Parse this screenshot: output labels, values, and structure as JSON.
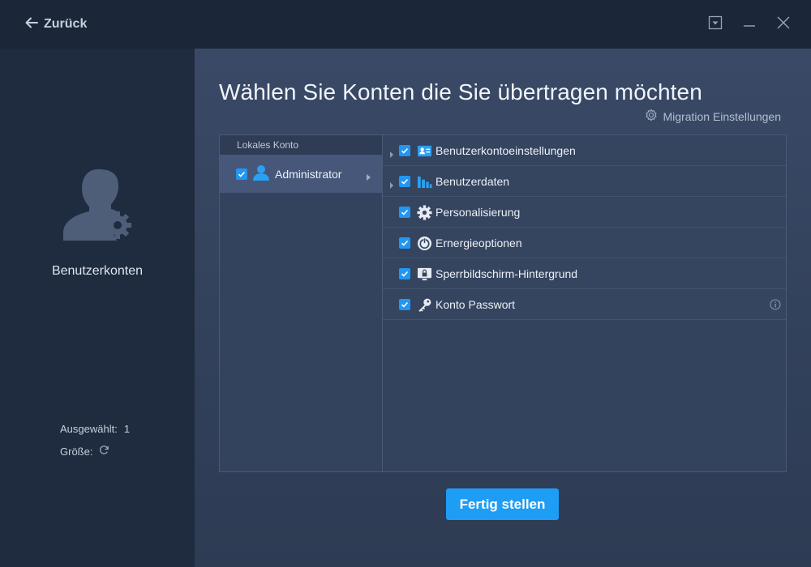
{
  "titlebar": {
    "back_label": "Zurück",
    "icons": [
      "arrow-left-icon",
      "dropdown-menu-icon",
      "minimize-icon",
      "close-icon"
    ]
  },
  "sidebar": {
    "title": "Benutzerkonten",
    "icon": "user-gear-icon",
    "selected_label": "Ausgewählt:",
    "selected_value": "1",
    "size_label": "Größe:",
    "size_icon": "refresh-icon"
  },
  "main": {
    "title": "Wählen Sie Konten die Sie übertragen möchten",
    "migration_settings_label": "Migration Einstellungen",
    "accounts": {
      "header": "Lokales Konto",
      "items": [
        {
          "label": "Administrator",
          "checked": true,
          "icon": "user-icon"
        }
      ]
    },
    "items": [
      {
        "label": "Benutzerkontoeinstellungen",
        "checked": true,
        "expandable": true,
        "icon": "user-card-icon"
      },
      {
        "label": "Benutzerdaten",
        "checked": true,
        "expandable": true,
        "icon": "bar-chart-icon"
      },
      {
        "label": "Personalisierung",
        "checked": true,
        "expandable": false,
        "icon": "gear-icon"
      },
      {
        "label": "Ernergieoptionen",
        "checked": true,
        "expandable": false,
        "icon": "power-icon"
      },
      {
        "label": "Sperrbildschirm-Hintergrund",
        "checked": true,
        "expandable": false,
        "icon": "lock-screen-icon"
      },
      {
        "label": "Konto Passwort",
        "checked": true,
        "expandable": false,
        "icon": "key-icon",
        "info": true
      }
    ],
    "finish_label": "Fertig stellen"
  },
  "colors": {
    "accent": "#1e9df5",
    "checkbox": "#2196f3",
    "sidebar_bg": "#1f2b3f",
    "main_bg": "#34435e"
  }
}
